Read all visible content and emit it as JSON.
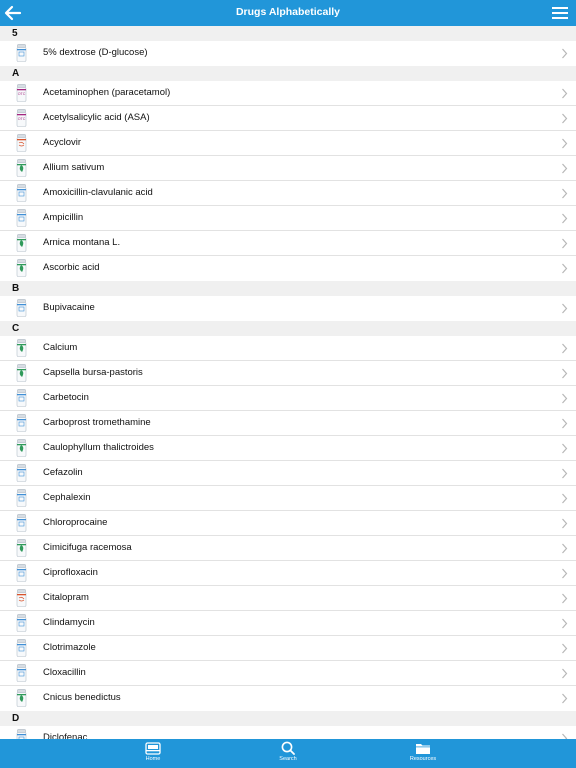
{
  "header": {
    "title": "Drugs Alphabetically"
  },
  "sections": [
    {
      "letter": "5",
      "items": [
        {
          "label": "5% dextrose (D-glucose)",
          "icon": "bottle-blue-icon"
        }
      ]
    },
    {
      "letter": "A",
      "items": [
        {
          "label": "Acetaminophen (paracetamol)",
          "icon": "bottle-purple-otc-icon"
        },
        {
          "label": "Acetylsalicylic acid (ASA)",
          "icon": "bottle-purple-otc-icon"
        },
        {
          "label": "Acyclovir",
          "icon": "bottle-orange-icon"
        },
        {
          "label": "Allium sativum",
          "icon": "bottle-green-leaf-icon"
        },
        {
          "label": "Amoxicillin-clavulanic acid",
          "icon": "bottle-blue-icon"
        },
        {
          "label": "Ampicillin",
          "icon": "bottle-blue-icon"
        },
        {
          "label": "Arnica montana L.",
          "icon": "bottle-green-leaf-icon"
        },
        {
          "label": "Ascorbic acid",
          "icon": "bottle-green-leaf-icon"
        }
      ]
    },
    {
      "letter": "B",
      "items": [
        {
          "label": "Bupivacaine",
          "icon": "bottle-blue-icon"
        }
      ]
    },
    {
      "letter": "C",
      "items": [
        {
          "label": "Calcium",
          "icon": "bottle-green-leaf-icon"
        },
        {
          "label": "Capsella bursa-pastoris",
          "icon": "bottle-green-leaf-icon"
        },
        {
          "label": "Carbetocin",
          "icon": "bottle-blue-icon"
        },
        {
          "label": "Carboprost tromethamine",
          "icon": "bottle-blue-icon"
        },
        {
          "label": "Caulophyllum thalictroides",
          "icon": "bottle-green-leaf-icon"
        },
        {
          "label": "Cefazolin",
          "icon": "bottle-blue-icon"
        },
        {
          "label": "Cephalexin",
          "icon": "bottle-blue-icon"
        },
        {
          "label": "Chloroprocaine",
          "icon": "bottle-blue-icon"
        },
        {
          "label": "Cimicifuga racemosa",
          "icon": "bottle-green-leaf-icon"
        },
        {
          "label": "Ciprofloxacin",
          "icon": "bottle-blue-icon"
        },
        {
          "label": "Citalopram",
          "icon": "bottle-orange-icon"
        },
        {
          "label": "Clindamycin",
          "icon": "bottle-blue-icon"
        },
        {
          "label": "Clotrimazole",
          "icon": "bottle-blue-icon"
        },
        {
          "label": "Cloxacillin",
          "icon": "bottle-blue-icon"
        },
        {
          "label": "Cnicus benedictus",
          "icon": "bottle-green-leaf-icon"
        }
      ]
    },
    {
      "letter": "D",
      "items": [
        {
          "label": "Diclofenac",
          "icon": "bottle-blue-icon"
        }
      ]
    }
  ],
  "tabs": [
    {
      "label": "Home",
      "icon": "home-icon"
    },
    {
      "label": "Search",
      "icon": "search-icon"
    },
    {
      "label": "Resources",
      "icon": "folder-icon"
    }
  ],
  "colors": {
    "bar": "#2196d9",
    "section_bg": "#f0f0f0",
    "blue_label": "#3f8fd6",
    "purple_label": "#a3257f",
    "orange_label": "#d9532b",
    "green_label": "#2f9a5a"
  }
}
